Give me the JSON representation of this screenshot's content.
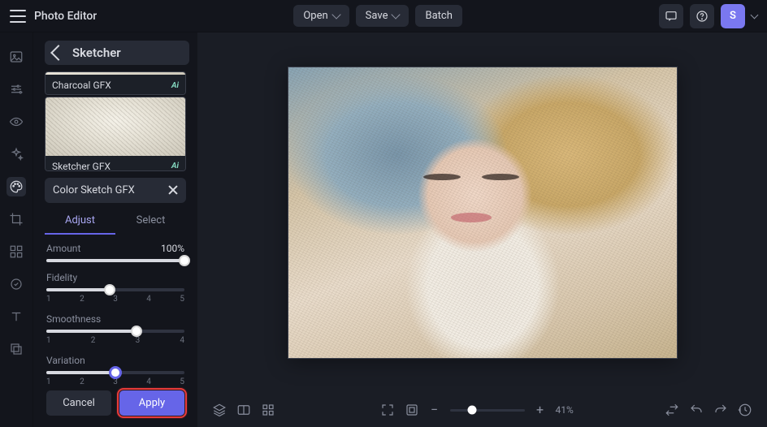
{
  "header": {
    "app_title": "Photo Editor",
    "open": "Open",
    "save": "Save",
    "batch": "Batch",
    "avatar": "S"
  },
  "panel": {
    "title": "Sketcher",
    "presets": [
      {
        "label": "Charcoal GFX",
        "badge": "Ai"
      },
      {
        "label": "Sketcher GFX",
        "badge": "Ai"
      }
    ],
    "active_preset": "Color Sketch GFX",
    "tabs": {
      "adjust": "Adjust",
      "select": "Select"
    },
    "sliders": {
      "amount": {
        "label": "Amount",
        "value": "100%",
        "pos": 100,
        "ticks": []
      },
      "fidelity": {
        "label": "Fidelity",
        "pos": 46,
        "ticks": [
          "1",
          "2",
          "3",
          "4",
          "5"
        ]
      },
      "smoothness": {
        "label": "Smoothness",
        "pos": 65,
        "ticks": [
          "1",
          "2",
          "3",
          "4"
        ]
      },
      "variation": {
        "label": "Variation",
        "pos": 50,
        "ticks": [
          "1",
          "2",
          "3",
          "4",
          "5"
        ]
      }
    },
    "buttons": {
      "cancel": "Cancel",
      "apply": "Apply"
    }
  },
  "statusbar": {
    "zoom": "41%"
  },
  "rail_icons": [
    "image",
    "sliders",
    "eye",
    "sparkles",
    "palette",
    "crop",
    "grid",
    "retouch",
    "text",
    "layers"
  ]
}
